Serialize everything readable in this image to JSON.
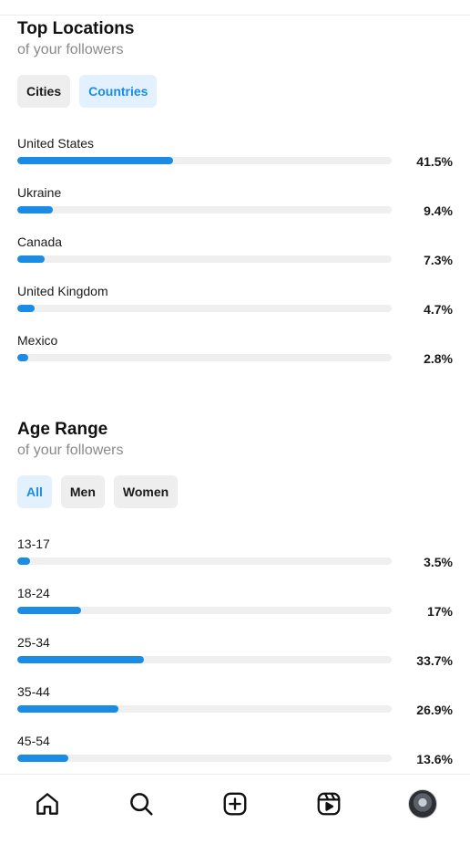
{
  "locations": {
    "title": "Top Locations",
    "subtitle": "of your followers",
    "tabs": [
      {
        "label": "Cities",
        "active": false
      },
      {
        "label": "Countries",
        "active": true
      }
    ],
    "rows": [
      {
        "label": "United States",
        "value": 41.5,
        "display": "41.5%"
      },
      {
        "label": "Ukraine",
        "value": 9.4,
        "display": "9.4%"
      },
      {
        "label": "Canada",
        "value": 7.3,
        "display": "7.3%"
      },
      {
        "label": "United Kingdom",
        "value": 4.7,
        "display": "4.7%"
      },
      {
        "label": "Mexico",
        "value": 2.8,
        "display": "2.8%"
      }
    ]
  },
  "age": {
    "title": "Age Range",
    "subtitle": "of your followers",
    "tabs": [
      {
        "label": "All",
        "active": true
      },
      {
        "label": "Men",
        "active": false
      },
      {
        "label": "Women",
        "active": false
      }
    ],
    "rows": [
      {
        "label": "13-17",
        "value": 3.5,
        "display": "3.5%"
      },
      {
        "label": "18-24",
        "value": 17,
        "display": "17%"
      },
      {
        "label": "25-34",
        "value": 33.7,
        "display": "33.7%"
      },
      {
        "label": "35-44",
        "value": 26.9,
        "display": "26.9%"
      },
      {
        "label": "45-54",
        "value": 13.6,
        "display": "13.6%"
      }
    ]
  },
  "bar_scale_max": 100,
  "colors": {
    "accent": "#1a8ce6",
    "track": "#efefef",
    "active_pill_bg": "#e3f1fe"
  },
  "nav": [
    {
      "icon": "home-icon"
    },
    {
      "icon": "search-icon"
    },
    {
      "icon": "create-icon"
    },
    {
      "icon": "reels-icon"
    },
    {
      "icon": "profile-avatar"
    }
  ]
}
